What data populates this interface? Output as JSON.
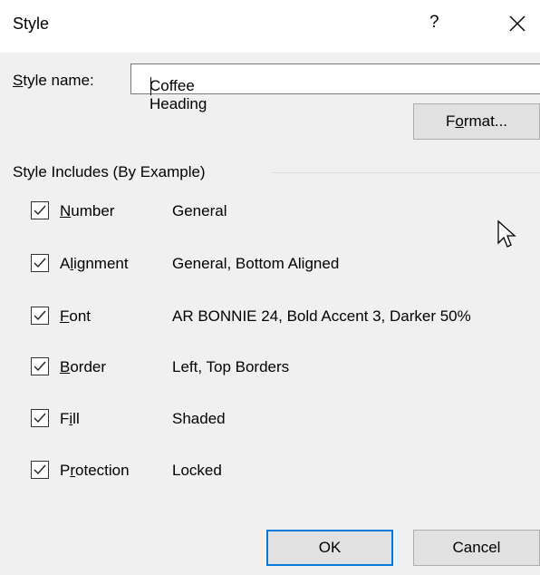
{
  "window": {
    "title": "Style",
    "help": "?",
    "close_icon": "close-icon"
  },
  "style_name": {
    "label": "Style name:",
    "value": "Coffee Heading"
  },
  "buttons": {
    "format": "Format...",
    "ok": "OK",
    "cancel": "Cancel"
  },
  "group": {
    "title": "Style Includes (By Example)",
    "items": [
      {
        "label": "Number",
        "value": "General",
        "checked": true
      },
      {
        "label": "Alignment",
        "value": "General, Bottom Aligned",
        "checked": true
      },
      {
        "label": "Font",
        "value": "AR BONNIE 24, Bold Accent 3, Darker 50%",
        "checked": true
      },
      {
        "label": "Border",
        "value": "Left, Top Borders",
        "checked": true
      },
      {
        "label": "Fill",
        "value": "Shaded",
        "checked": true
      },
      {
        "label": "Protection",
        "value": "Locked",
        "checked": true
      }
    ]
  },
  "colors": {
    "accent": "#0078d7",
    "background": "#f0f0f0",
    "titlebar": "#ffffff"
  }
}
